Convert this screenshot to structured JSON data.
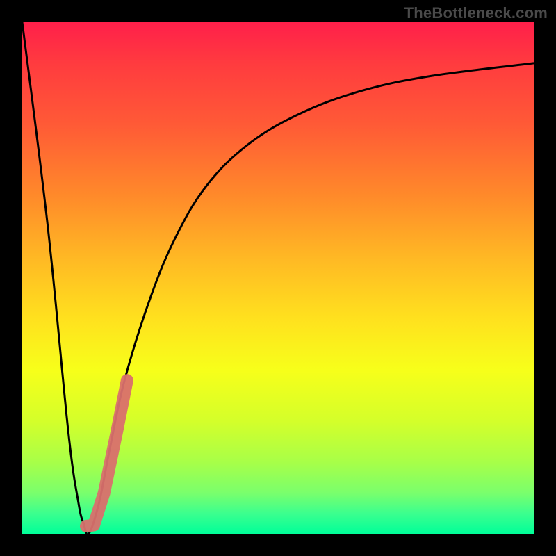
{
  "watermark": {
    "text": "TheBottleneck.com"
  },
  "colors": {
    "frame": "#000000",
    "curve": "#000000",
    "marker": "#d9706d"
  },
  "chart_data": {
    "type": "line",
    "title": "",
    "xlabel": "",
    "ylabel": "",
    "xlim": [
      0,
      100
    ],
    "ylim": [
      0,
      100
    ],
    "grid": false,
    "legend": false,
    "series": [
      {
        "name": "bottleneck-curve",
        "x": [
          0,
          5,
          9,
          11,
          12,
          13,
          15,
          17,
          20,
          25,
          30,
          36,
          44,
          54,
          66,
          80,
          100
        ],
        "y": [
          100,
          60,
          20,
          6,
          2,
          0,
          6,
          16,
          30,
          46,
          58,
          68,
          76,
          82,
          86.5,
          89.5,
          92
        ]
      }
    ],
    "marker": {
      "name": "highlight-segment",
      "points": [
        {
          "x": 12.5,
          "y": 1.5
        },
        {
          "x": 14.0,
          "y": 1.7
        },
        {
          "x": 16.0,
          "y": 8.0
        },
        {
          "x": 18.5,
          "y": 20.0
        },
        {
          "x": 20.5,
          "y": 30.0
        }
      ]
    }
  }
}
